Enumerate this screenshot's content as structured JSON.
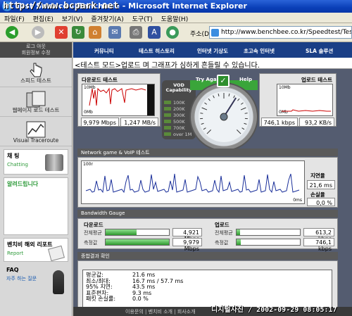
{
  "window": {
    "title": "Test Service - Benchbee - Microsoft Internet Explorer",
    "watermark": "http://www.bcpark.net",
    "timestamp": "디지털사진 / 2002-09-29 08:05:17"
  },
  "menu": [
    "파일(F)",
    "편집(E)",
    "보기(V)",
    "즐겨찾기(A)",
    "도구(T)",
    "도움말(H)"
  ],
  "address": {
    "label": "주소(D)",
    "url": "http://www.benchbee.co.kr/Speedtest/TestSt"
  },
  "left": {
    "login": [
      "로그 아웃",
      "회원정보 수정"
    ],
    "nav": [
      "스피드 테스트",
      "웹페이지 로드 테스트",
      "Visual Traceroute"
    ],
    "chat": {
      "title": "채 팅",
      "sub": "Chatting"
    },
    "notice": {
      "title": "알려드립니다"
    },
    "report": {
      "title": "벤치비 해외 리포트",
      "sub": "Report"
    },
    "faq": {
      "title": "FAQ",
      "sub": "자주 하는 질문"
    }
  },
  "topnav": [
    "커뮤니티",
    "테스트 히스토리",
    "인터넷 기상도",
    "초고속 인터넷",
    "SLA 솔루션"
  ],
  "mode_text": "<테스트 모드>업로드 며 그래프가 심하게 흔들릴 수 있습니다.",
  "download": {
    "title": "다운로드 테스트",
    "scale_top": "10Mb",
    "scale_bottom": "0Mb",
    "mbps": "9,979 Mbps",
    "mbs": "1,247 MB/s"
  },
  "upload": {
    "title": "업로드 테스트",
    "scale_top": "10Mb",
    "scale_bottom": "0Mb",
    "kbps": "746,1 kbps",
    "kbs": "93,2 KB/s"
  },
  "vod": {
    "title": "VOD Capability",
    "levels": [
      "100K",
      "200K",
      "300K",
      "500K",
      "700K",
      "over 1M"
    ]
  },
  "gauge": {
    "try_again": "Try Again",
    "help": "Help",
    "value_fraction": 0.62
  },
  "network": {
    "title": "Network game & VoIP 테스트",
    "scale_top": "100r",
    "scale_bottom": "0ms",
    "latency_label": "지연율",
    "latency": "21,6 ms",
    "loss_label": "손실율",
    "loss": "0,0 %"
  },
  "bandwidth": {
    "title": "Bandwidth Gauge",
    "down": {
      "title": "다운로드",
      "avg_label": "전체평균",
      "avg": "4,921 Mbps",
      "avg_fill": 0.49,
      "meas_label": "측정값",
      "meas": "9,979 Mbps",
      "meas_fill": 1.0
    },
    "up": {
      "title": "업로드",
      "avg_label": "전체평균",
      "avg": "613,2 kbps",
      "avg_fill": 0.06,
      "meas_label": "측정값",
      "meas": "746,1 kbps",
      "meas_fill": 0.07
    }
  },
  "summary": {
    "title": "종합결과 확인",
    "rows": [
      [
        "평균값:",
        "21.6 ms"
      ],
      [
        "최소/최대:",
        "16.7 ms / 57.7 ms"
      ],
      [
        "95% 지연:",
        "43.5 ms"
      ],
      [
        "표준편차:",
        "9.3 ms"
      ],
      [
        "패킷 손실률:",
        "0.0 %"
      ]
    ]
  },
  "footer": {
    "links": "이용문의 | 벤치비 소개 | 회사소개"
  }
}
